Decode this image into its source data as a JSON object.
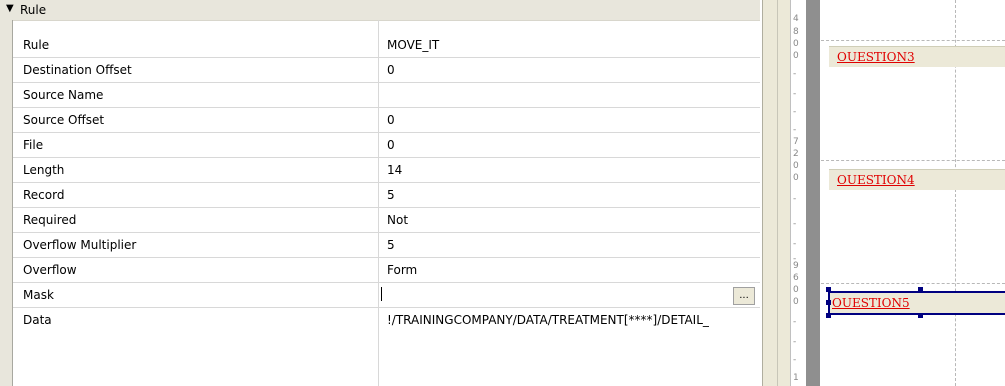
{
  "grid": {
    "category": "Rule",
    "rows": [
      {
        "name": "Rule",
        "value": "MOVE_IT"
      },
      {
        "name": "Destination Offset",
        "value": "0"
      },
      {
        "name": "Source Name",
        "value": ""
      },
      {
        "name": "Source Offset",
        "value": "0"
      },
      {
        "name": "File",
        "value": "0"
      },
      {
        "name": "Length",
        "value": "14"
      },
      {
        "name": "Record",
        "value": "5"
      },
      {
        "name": "Required",
        "value": "Not"
      },
      {
        "name": "Overflow Multiplier",
        "value": "5"
      },
      {
        "name": "Overflow",
        "value": "Form"
      },
      {
        "name": "Mask",
        "value": ""
      },
      {
        "name": "Data",
        "value": "!/TRAININGCOMPANY/DATA/TREATMENT[****]/DETAIL_"
      }
    ],
    "ellipsis_label": "..."
  },
  "ruler": {
    "ticks": [
      "4",
      "8",
      "0",
      "0",
      "-",
      "-",
      "-",
      "-",
      "7",
      "2",
      "0",
      "0",
      "-",
      "-",
      "-",
      "-",
      "9",
      "6",
      "0",
      "0",
      "-",
      "-",
      "-",
      "1"
    ]
  },
  "canvas": {
    "fields": [
      {
        "label": "OUESTION3"
      },
      {
        "label": "OUESTION4"
      },
      {
        "label": "OUESTION5"
      }
    ]
  }
}
